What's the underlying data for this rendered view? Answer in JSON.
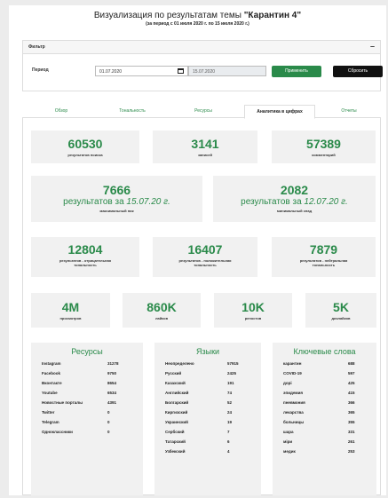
{
  "header": {
    "title_prefix": "Визуализация по результатам темы ",
    "title_topic": "\"Карантин 4\"",
    "subtitle": "(за период с 01 июля 2020 г. по 15 июля 2020 г.)"
  },
  "filter": {
    "header_label": "Фильтр",
    "collapse_symbol": "–",
    "period_label": "Период",
    "date_from": "01.07.2020",
    "date_to": "15.07.2020",
    "apply_label": "Применить",
    "reset_label": "Сбросить"
  },
  "tabs": [
    "Обзор",
    "Тональность",
    "Ресурсы",
    "Аналитика в цифрах",
    "Отчеты"
  ],
  "active_tab": 3,
  "stats_row1": [
    {
      "value": "60530",
      "caption": "результатов поиска"
    },
    {
      "value": "3141",
      "caption": "записей"
    },
    {
      "value": "57389",
      "caption": "комментарий"
    }
  ],
  "stats_row2": [
    {
      "value": "7666",
      "line": "результатов за",
      "date": "15.07.20 г.",
      "caption": "максимальный пик"
    },
    {
      "value": "2082",
      "line": "результатов за",
      "date": "12.07.20 г.",
      "caption": "минимальный спад"
    }
  ],
  "stats_row3": [
    {
      "value": "12804",
      "caption": "результатов - отрицательная тональность"
    },
    {
      "value": "16407",
      "caption": "результатов - положительная тональность"
    },
    {
      "value": "7879",
      "caption": "результатов - нейтральная тональность"
    }
  ],
  "stats_row4": [
    {
      "value": "4M",
      "caption": "просмотров"
    },
    {
      "value": "860K",
      "caption": "лайков"
    },
    {
      "value": "10K",
      "caption": "репостов"
    },
    {
      "value": "5K",
      "caption": "дизлайков"
    }
  ],
  "resources": {
    "title": "Ресурсы",
    "rows": [
      {
        "name": "Instagram",
        "value": "31278"
      },
      {
        "name": "Facebook",
        "value": "9750"
      },
      {
        "name": "Вконтакте",
        "value": "8654"
      },
      {
        "name": "Youtube",
        "value": "6534"
      },
      {
        "name": "Новостные порталы",
        "value": "4391"
      },
      {
        "name": "Twitter",
        "value": "0"
      },
      {
        "name": "Telegram",
        "value": "0"
      },
      {
        "name": "Одноклассники",
        "value": "0"
      }
    ]
  },
  "languages": {
    "title": "Языки",
    "rows": [
      {
        "name": "Неопределено",
        "value": "57915"
      },
      {
        "name": "Русский",
        "value": "2425"
      },
      {
        "name": "Казахский",
        "value": "191"
      },
      {
        "name": "Английский",
        "value": "74"
      },
      {
        "name": "Болгарский",
        "value": "52"
      },
      {
        "name": "Киргизский",
        "value": "24"
      },
      {
        "name": "Украинский",
        "value": "19"
      },
      {
        "name": "Сербский",
        "value": "7"
      },
      {
        "name": "Татарский",
        "value": "6"
      },
      {
        "name": "Узбекский",
        "value": "4"
      }
    ]
  },
  "keywords": {
    "title": "Ключевые слова",
    "rows": [
      {
        "name": "карантин",
        "value": "688"
      },
      {
        "name": "COVID-19",
        "value": "597"
      },
      {
        "name": "дорі",
        "value": "425"
      },
      {
        "name": "эпидемия",
        "value": "415"
      },
      {
        "name": "пневмония",
        "value": "366"
      },
      {
        "name": "лекарства",
        "value": "365"
      },
      {
        "name": "больницы",
        "value": "355"
      },
      {
        "name": "шара",
        "value": "331"
      },
      {
        "name": "міри",
        "value": "261"
      },
      {
        "name": "медик",
        "value": "253"
      }
    ]
  }
}
